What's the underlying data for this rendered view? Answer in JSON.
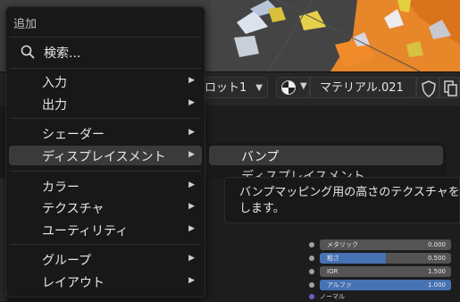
{
  "menu": {
    "title": "追加",
    "search_label": "検索...",
    "items": [
      {
        "label": "入力"
      },
      {
        "label": "出力"
      },
      {
        "label": "シェーダー"
      },
      {
        "label": "ディスプレイスメント"
      },
      {
        "label": "カラー"
      },
      {
        "label": "テクスチャ"
      },
      {
        "label": "ユーティリティ"
      },
      {
        "label": "グループ"
      },
      {
        "label": "レイアウト"
      }
    ]
  },
  "submenu": {
    "highlighted": "バンプ",
    "next_partial": "ディスプレイスメント"
  },
  "tooltip": {
    "text": "バンプマッピング用の高さのテクスチャを作成します。"
  },
  "header": {
    "slot_label": "ロット1",
    "material_name": "マテリアル.021"
  },
  "node_sockets": [
    {
      "label": "メタリック",
      "value": "0.000",
      "fill": 0.0
    },
    {
      "label": "粗さ",
      "value": "0.500",
      "fill": 0.5
    },
    {
      "label": "IOR",
      "value": "1.500",
      "fill": 0.0
    },
    {
      "label": "アルファ",
      "value": "1.000",
      "fill": 1.0
    },
    {
      "label": "ノーマル"
    }
  ],
  "colors": {
    "menu_bg": "#181818",
    "highlight": "#3a3a3a",
    "slider_fill": "#4772b3",
    "viewport_orange": "#e8862a",
    "viewport_yellow": "#d9c13a"
  }
}
